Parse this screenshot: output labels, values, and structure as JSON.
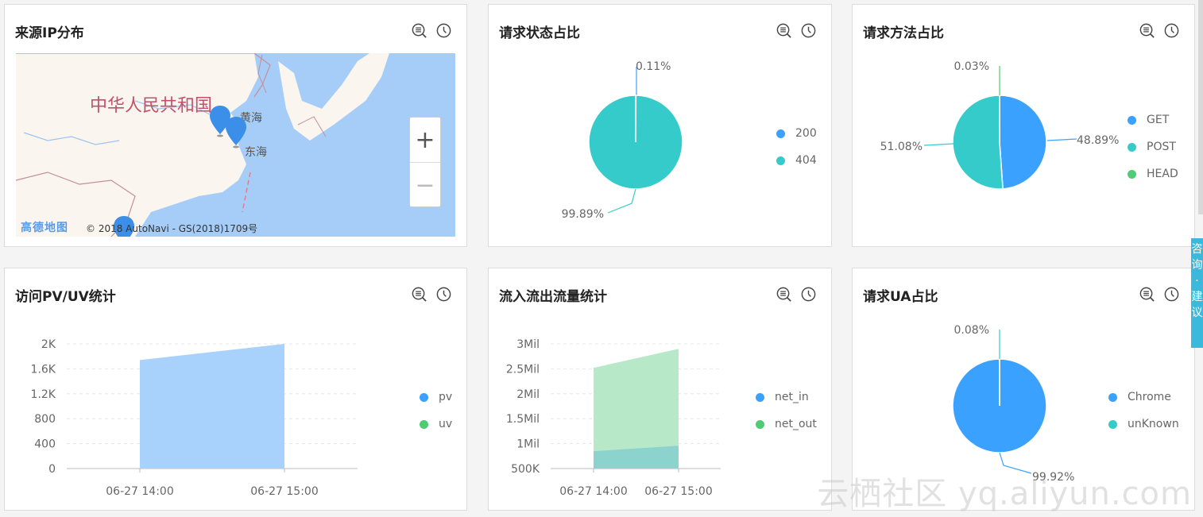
{
  "cards": {
    "ip_map": {
      "title": "来源IP分布",
      "labels": {
        "country": "中华人民共和国",
        "yellow_sea": "黄海",
        "east_sea": "东海"
      },
      "logo": "高德地图",
      "copyright": "© 2018 AutoNavi - GS(2018)1709号",
      "zoom_in": "+",
      "zoom_out": "−"
    },
    "status": {
      "title": "请求状态占比"
    },
    "method": {
      "title": "请求方法占比"
    },
    "pvuv": {
      "title": "访问PV/UV统计"
    },
    "traffic": {
      "title": "流入流出流量统计"
    },
    "ua": {
      "title": "请求UA占比"
    }
  },
  "icons": {
    "zoom": "zoom-list-icon",
    "history": "clock-icon"
  },
  "side_tab": "咨询·建议",
  "watermark": "云栖社区 yq.aliyun.com",
  "colors": {
    "blue": "#3ba1ff",
    "teal": "#36cbcb",
    "green": "#4ecb73",
    "area_blue": "#a8d2fb",
    "area_green": "#b7e8c8",
    "area_teal": "#8cd3cd"
  },
  "chart_data": [
    {
      "id": "status",
      "type": "pie",
      "series": [
        {
          "name": "200",
          "value": 0.11,
          "label": "0.11%",
          "color": "#3ba1ff"
        },
        {
          "name": "404",
          "value": 99.89,
          "label": "99.89%",
          "color": "#36cbcb"
        }
      ]
    },
    {
      "id": "method",
      "type": "pie",
      "series": [
        {
          "name": "GET",
          "value": 48.89,
          "label": "48.89%",
          "color": "#3ba1ff"
        },
        {
          "name": "POST",
          "value": 51.08,
          "label": "51.08%",
          "color": "#36cbcb"
        },
        {
          "name": "HEAD",
          "value": 0.03,
          "label": "0.03%",
          "color": "#4ecb73"
        }
      ]
    },
    {
      "id": "ua",
      "type": "pie",
      "series": [
        {
          "name": "Chrome",
          "value": 99.92,
          "label": "99.92%",
          "color": "#3ba1ff"
        },
        {
          "name": "unKnown",
          "value": 0.08,
          "label": "0.08%",
          "color": "#36cbcb"
        }
      ]
    },
    {
      "id": "pvuv",
      "type": "area",
      "x": [
        "06-27 14:00",
        "06-27 15:00"
      ],
      "ylim": [
        0,
        2000
      ],
      "yticks": [
        "0",
        "400",
        "800",
        "1.2K",
        "1.6K",
        "2K"
      ],
      "series": [
        {
          "name": "pv",
          "values": [
            1740,
            2000
          ],
          "color": "#3ba1ff",
          "fill": "#a8d2fb"
        },
        {
          "name": "uv",
          "values": [
            0,
            0
          ],
          "color": "#4ecb73",
          "fill": "#b7e8c8"
        }
      ]
    },
    {
      "id": "traffic",
      "type": "area",
      "x": [
        "06-27 14:00",
        "06-27 15:00"
      ],
      "ylim": [
        500000,
        3000000
      ],
      "yticks": [
        "500K",
        "1Mil",
        "1.5Mil",
        "2Mil",
        "2.5Mil",
        "3Mil"
      ],
      "series": [
        {
          "name": "net_in",
          "values": [
            850000,
            960000
          ],
          "color": "#3ba1ff",
          "fill": "#8cd3cd"
        },
        {
          "name": "net_out",
          "values": [
            2520000,
            2900000
          ],
          "color": "#4ecb73",
          "fill": "#b7e8c8"
        }
      ]
    }
  ]
}
